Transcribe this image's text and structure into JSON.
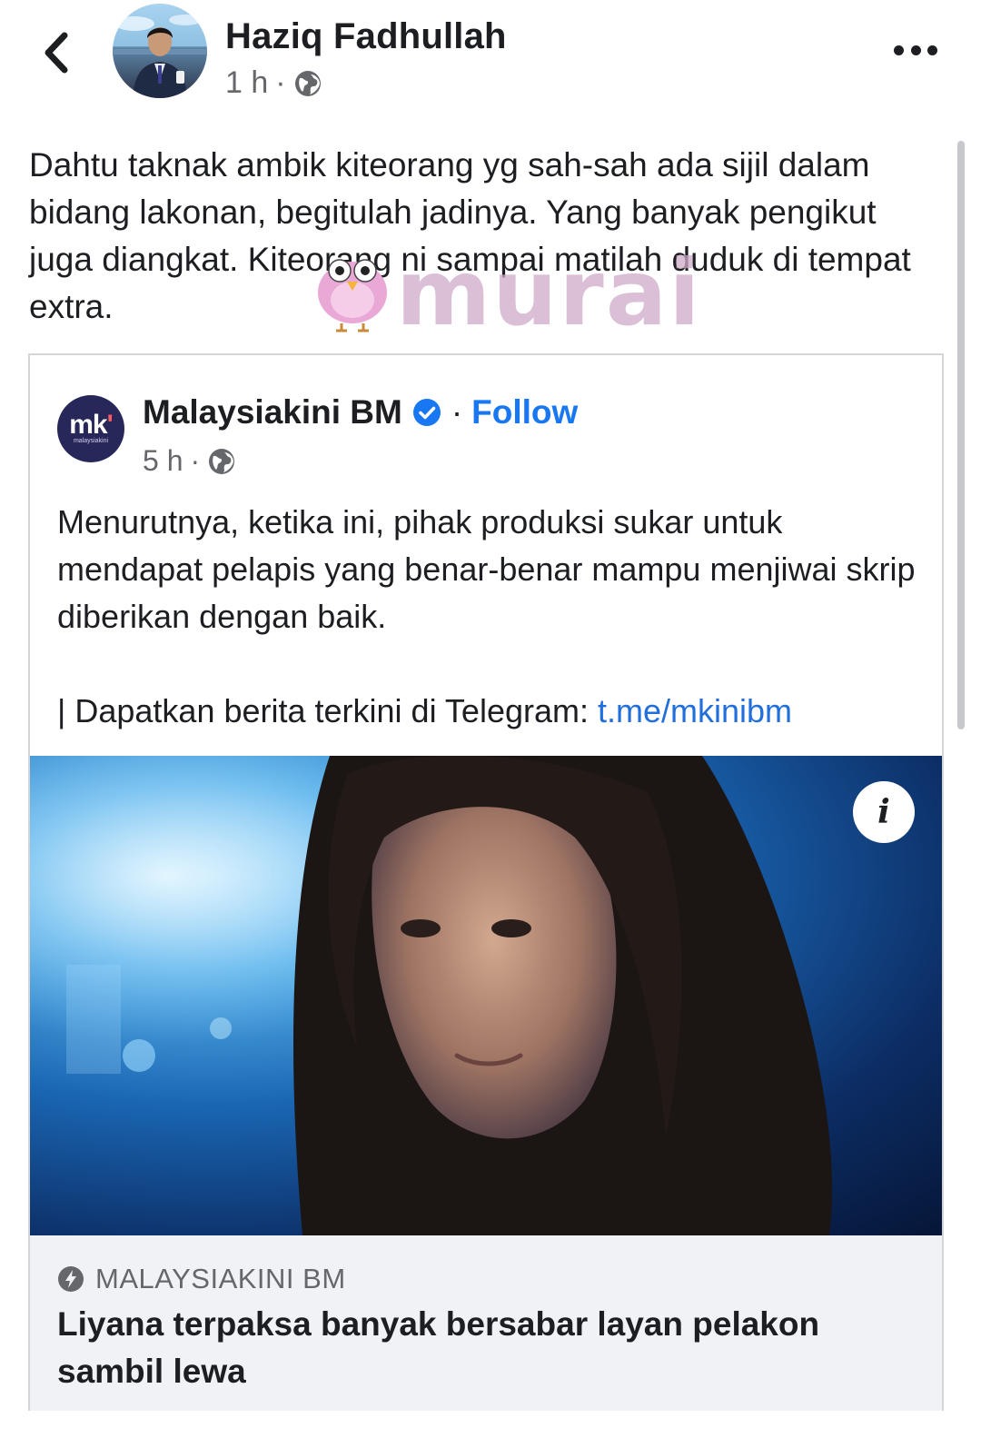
{
  "post": {
    "author": "Haziq Fadhullah",
    "time": "1 h",
    "separator": "·",
    "text": "Dahtu taknak ambik kiteorang yg sah-sah ada sijil dalam bidang lakonan, begitulah jadinya. Yang banyak pengikut juga diangkat. Kiteorang ni sampai matilah duduk di tempat extra."
  },
  "watermark": {
    "text": "murai"
  },
  "shared": {
    "page_name": "Malaysiakini BM",
    "separator": "·",
    "follow_label": "Follow",
    "time": "5 h",
    "logo_text": "mk",
    "logo_accent": "'",
    "logo_sub": "malaysiakini",
    "paragraph": "Menurutnya, ketika ini, pihak produksi sukar untuk mendapat pelapis yang benar-benar mampu menjiwai skrip diberikan dengan baik.",
    "telegram_prefix": "| Dapatkan berita terkini di Telegram: ",
    "telegram_link": "t.me/mkinibm"
  },
  "link_preview": {
    "info_label": "i",
    "source": "MALAYSIAKINI BM",
    "headline": "Liyana terpaksa banyak bersabar layan pelakon sambil lewa"
  },
  "icons": {
    "back": "chevron-left-icon",
    "privacy": "globe-icon",
    "more": "more-horizontal-icon",
    "verified": "verified-badge-icon",
    "source": "lightning-bolt-icon",
    "info": "info-icon"
  },
  "colors": {
    "link": "#216fdb",
    "follow": "#1877f2",
    "text": "#1c1e21",
    "secondary": "#65676b",
    "preview_bg": "#f0f2f5"
  }
}
